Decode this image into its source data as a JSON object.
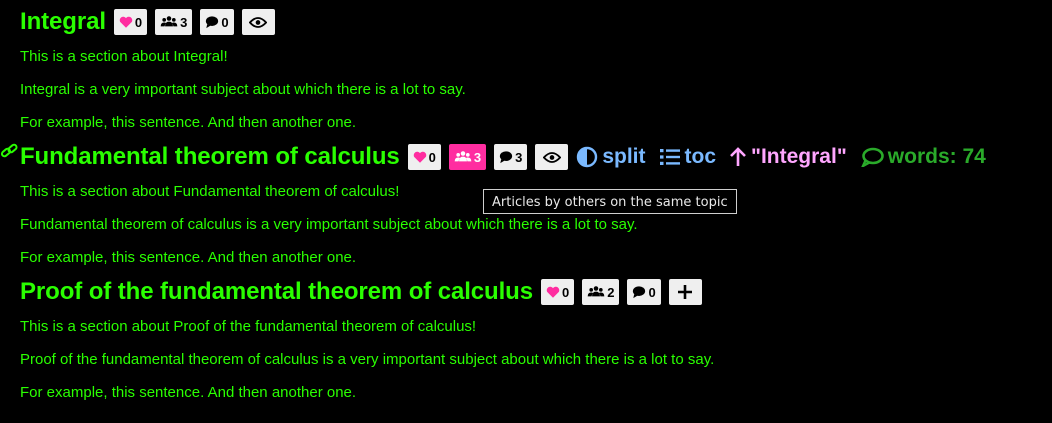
{
  "colors": {
    "background": "#000000",
    "heading": "#2aff00",
    "button_bg": "#efefef",
    "active_button_bg": "#ff2da0",
    "heart": "#ff2da0",
    "nav_blue": "#7ab9ff",
    "nav_pink": "#ffa6ff",
    "nav_green": "#2aaa2a"
  },
  "sections": [
    {
      "title": "Integral",
      "likes": "0",
      "others": "3",
      "comments": "0",
      "paragraphs": [
        "This is a section about Integral!",
        "Integral is a very important subject about which there is a lot to say.",
        "For example, this sentence. And then another one."
      ]
    },
    {
      "title": "Fundamental theorem of calculus",
      "likes": "0",
      "others": "3",
      "comments": "3",
      "nav": {
        "split_label": "split",
        "toc_label": "toc",
        "parent_label": "\"Integral\"",
        "words_label": "words: 74"
      },
      "paragraphs": [
        "This is a section about Fundamental theorem of calculus!",
        "Fundamental theorem of calculus is a very important subject about which there is a lot to say.",
        "For example, this sentence. And then another one."
      ]
    },
    {
      "title": "Proof of the fundamental theorem of calculus",
      "likes": "0",
      "others": "2",
      "comments": "0",
      "paragraphs": [
        "This is a section about Proof of the fundamental theorem of calculus!",
        "Proof of the fundamental theorem of calculus is a very important subject about which there is a lot to say.",
        "For example, this sentence. And then another one."
      ]
    }
  ],
  "tooltip": "Articles by others on the same topic"
}
